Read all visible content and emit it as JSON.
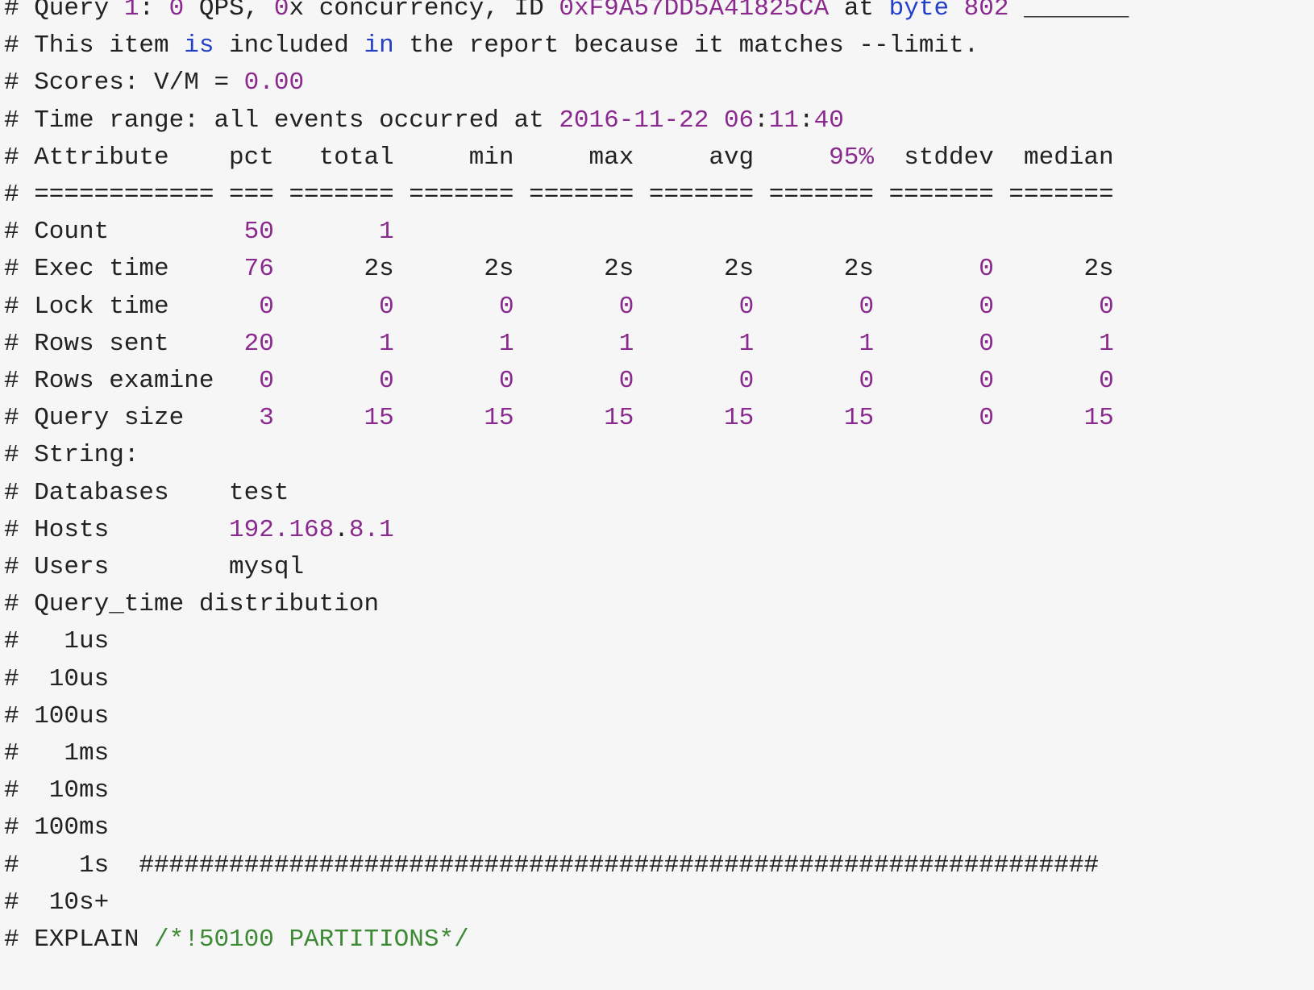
{
  "colors": {
    "text": "#222222",
    "number": "#8a2a8e",
    "keyword": "#2440c8",
    "comment": "#3d8a35",
    "background": "#f6f6f6"
  },
  "lines": [
    [
      [
        "t",
        "# Query "
      ],
      [
        "n",
        "1"
      ],
      [
        "t",
        ": "
      ],
      [
        "n",
        "0"
      ],
      [
        "t",
        " QPS, "
      ],
      [
        "n",
        "0"
      ],
      [
        "t",
        "x concurrency, ID "
      ],
      [
        "n",
        "0xF9A57DD5A41825CA"
      ],
      [
        "t",
        " at "
      ],
      [
        "k",
        "byte"
      ],
      [
        "t",
        " "
      ],
      [
        "n",
        "802"
      ],
      [
        "t",
        " _______"
      ]
    ],
    [
      [
        "t",
        "# This item "
      ],
      [
        "k",
        "is"
      ],
      [
        "t",
        " included "
      ],
      [
        "k",
        "in"
      ],
      [
        "t",
        " the report because it matches --limit."
      ]
    ],
    [
      [
        "t",
        "# Scores: V/M = "
      ],
      [
        "n",
        "0.00"
      ]
    ],
    [
      [
        "t",
        "# Time range: all events occurred at "
      ],
      [
        "n",
        "2016-11-22"
      ],
      [
        "t",
        " "
      ],
      [
        "n",
        "06"
      ],
      [
        "t",
        ":"
      ],
      [
        "n",
        "11"
      ],
      [
        "t",
        ":"
      ],
      [
        "n",
        "40"
      ]
    ],
    [
      [
        "t",
        "# Attribute    pct   total     min     max     avg     "
      ],
      [
        "n",
        "95%"
      ],
      [
        "t",
        "  stddev  median"
      ]
    ],
    [
      [
        "t",
        "# ============ === ======= ======= ======= ======= ======= ======= ======="
      ]
    ],
    [
      [
        "t",
        "# Count         "
      ],
      [
        "n",
        "50"
      ],
      [
        "t",
        "       "
      ],
      [
        "n",
        "1"
      ]
    ],
    [
      [
        "t",
        "# Exec time     "
      ],
      [
        "n",
        "76"
      ],
      [
        "t",
        "      2s      2s      2s      2s      2s       "
      ],
      [
        "n",
        "0"
      ],
      [
        "t",
        "      2s"
      ]
    ],
    [
      [
        "t",
        "# Lock time      "
      ],
      [
        "n",
        "0"
      ],
      [
        "t",
        "       "
      ],
      [
        "n",
        "0"
      ],
      [
        "t",
        "       "
      ],
      [
        "n",
        "0"
      ],
      [
        "t",
        "       "
      ],
      [
        "n",
        "0"
      ],
      [
        "t",
        "       "
      ],
      [
        "n",
        "0"
      ],
      [
        "t",
        "       "
      ],
      [
        "n",
        "0"
      ],
      [
        "t",
        "       "
      ],
      [
        "n",
        "0"
      ],
      [
        "t",
        "       "
      ],
      [
        "n",
        "0"
      ]
    ],
    [
      [
        "t",
        "# Rows sent     "
      ],
      [
        "n",
        "20"
      ],
      [
        "t",
        "       "
      ],
      [
        "n",
        "1"
      ],
      [
        "t",
        "       "
      ],
      [
        "n",
        "1"
      ],
      [
        "t",
        "       "
      ],
      [
        "n",
        "1"
      ],
      [
        "t",
        "       "
      ],
      [
        "n",
        "1"
      ],
      [
        "t",
        "       "
      ],
      [
        "n",
        "1"
      ],
      [
        "t",
        "       "
      ],
      [
        "n",
        "0"
      ],
      [
        "t",
        "       "
      ],
      [
        "n",
        "1"
      ]
    ],
    [
      [
        "t",
        "# Rows examine   "
      ],
      [
        "n",
        "0"
      ],
      [
        "t",
        "       "
      ],
      [
        "n",
        "0"
      ],
      [
        "t",
        "       "
      ],
      [
        "n",
        "0"
      ],
      [
        "t",
        "       "
      ],
      [
        "n",
        "0"
      ],
      [
        "t",
        "       "
      ],
      [
        "n",
        "0"
      ],
      [
        "t",
        "       "
      ],
      [
        "n",
        "0"
      ],
      [
        "t",
        "       "
      ],
      [
        "n",
        "0"
      ],
      [
        "t",
        "       "
      ],
      [
        "n",
        "0"
      ]
    ],
    [
      [
        "t",
        "# Query size     "
      ],
      [
        "n",
        "3"
      ],
      [
        "t",
        "      "
      ],
      [
        "n",
        "15"
      ],
      [
        "t",
        "      "
      ],
      [
        "n",
        "15"
      ],
      [
        "t",
        "      "
      ],
      [
        "n",
        "15"
      ],
      [
        "t",
        "      "
      ],
      [
        "n",
        "15"
      ],
      [
        "t",
        "      "
      ],
      [
        "n",
        "15"
      ],
      [
        "t",
        "       "
      ],
      [
        "n",
        "0"
      ],
      [
        "t",
        "      "
      ],
      [
        "n",
        "15"
      ]
    ],
    [
      [
        "t",
        "# String:"
      ]
    ],
    [
      [
        "t",
        "# Databases    test"
      ]
    ],
    [
      [
        "t",
        "# Hosts        "
      ],
      [
        "n",
        "192.168"
      ],
      [
        "t",
        "."
      ],
      [
        "n",
        "8.1"
      ]
    ],
    [
      [
        "t",
        "# Users        mysql"
      ]
    ],
    [
      [
        "t",
        "# Query_time distribution"
      ]
    ],
    [
      [
        "t",
        "#   1us"
      ]
    ],
    [
      [
        "t",
        "#  10us"
      ]
    ],
    [
      [
        "t",
        "# 100us"
      ]
    ],
    [
      [
        "t",
        "#   1ms"
      ]
    ],
    [
      [
        "t",
        "#  10ms"
      ]
    ],
    [
      [
        "t",
        "# 100ms"
      ]
    ],
    [
      [
        "t",
        "#    1s  ################################################################"
      ]
    ],
    [
      [
        "t",
        "#  10s+"
      ]
    ],
    [
      [
        "t",
        "# EXPLAIN "
      ],
      [
        "c",
        "/*!50100 PARTITIONS*/"
      ]
    ]
  ]
}
